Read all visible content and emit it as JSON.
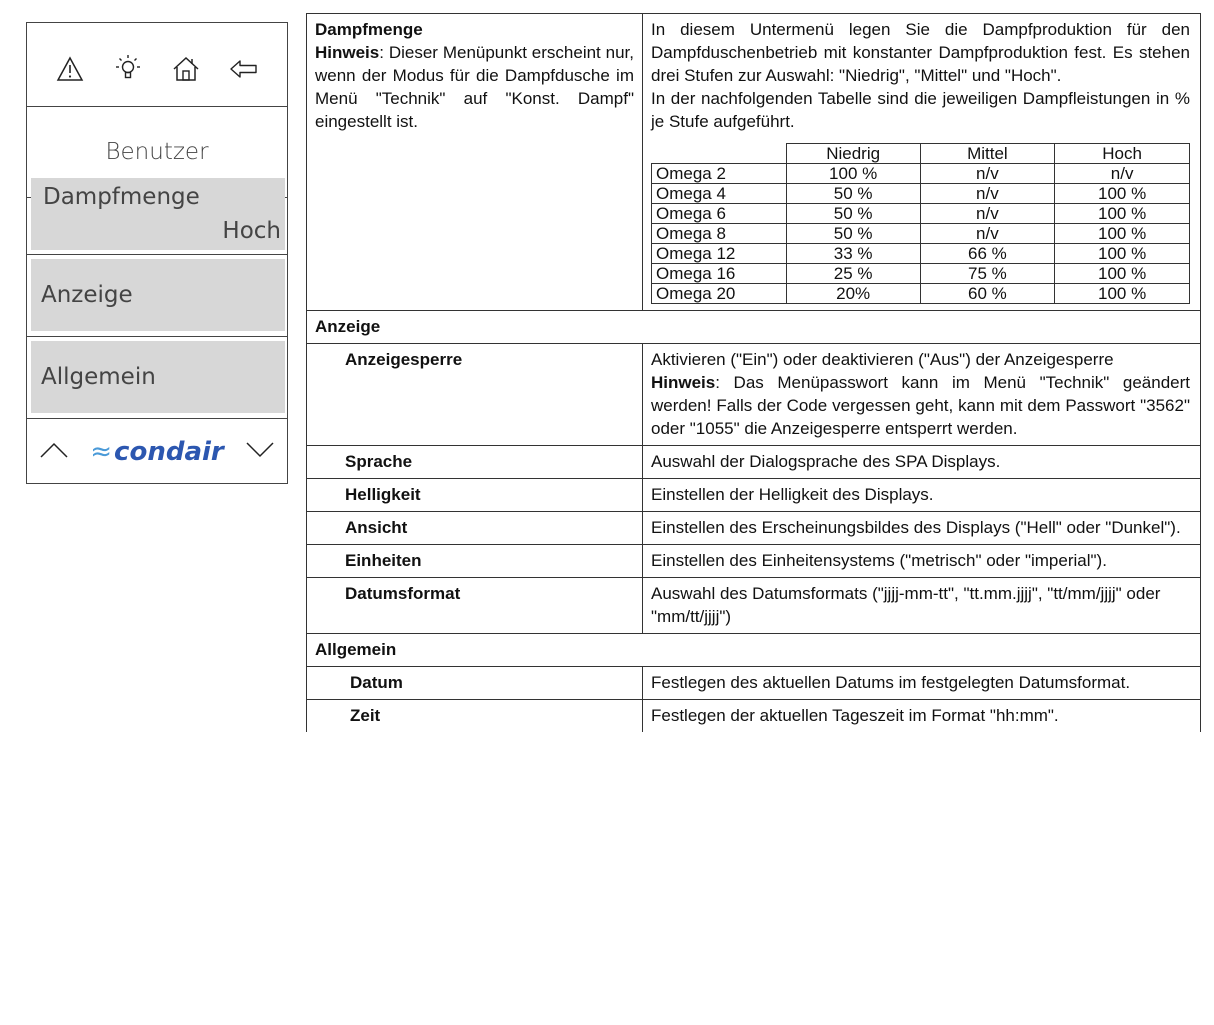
{
  "device": {
    "icons": [
      "warning-icon",
      "bulb-icon",
      "home-icon",
      "back-arrow-icon"
    ],
    "title": "Benutzer",
    "menu": [
      {
        "label": "Dampfmenge",
        "value": "Hoch"
      },
      {
        "label": "Anzeige"
      },
      {
        "label": "Allgemein"
      }
    ],
    "logo": "condair"
  },
  "dampf": {
    "title": "Dampfmenge",
    "note_label": "Hinweis",
    "note_text": ": Dieser Menüpunkt erscheint nur, wenn der Modus für die Dampfdusche im Menü \"Technik\" auf \"Konst. Dampf\" eingestellt ist.",
    "desc1": "In diesem Untermenü legen Sie die Dampfproduktion für den Dampfduschenbetrieb mit konstanter Dampfproduktion fest. Es stehen drei Stufen zur Auswahl: \"Niedrig\", \"Mittel\" und \"Hoch\".",
    "desc2": "In der nachfolgenden Tabelle sind die jeweiligen Dampfleistungen in % je Stufe aufgeführt.",
    "table": {
      "headers": [
        "Niedrig",
        "Mittel",
        "Hoch"
      ],
      "rows": [
        [
          "Omega 2",
          "100 %",
          "n/v",
          "n/v"
        ],
        [
          "Omega 4",
          "50 %",
          "n/v",
          "100 %"
        ],
        [
          "Omega 6",
          "50 %",
          "n/v",
          "100 %"
        ],
        [
          "Omega 8",
          "50 %",
          "n/v",
          "100 %"
        ],
        [
          "Omega 12",
          "33 %",
          "66 %",
          "100 %"
        ],
        [
          "Omega 16",
          "25 %",
          "75 %",
          "100 %"
        ],
        [
          "Omega 20",
          "20%",
          "60 %",
          "100 %"
        ]
      ]
    }
  },
  "anzeige": {
    "heading": "Anzeige",
    "rows": [
      {
        "label": "Anzeigesperre",
        "desc": "Aktivieren (\"Ein\") oder deaktivieren (\"Aus\") der Anzeigesperre",
        "note_label": "Hinweis",
        "note_text": ": Das Menüpasswort kann im Menü \"Technik\" geändert werden! Falls der Code vergessen geht, kann mit dem Passwort \"3562\" oder \"1055\" die Anzeigesperre entsperrt werden."
      },
      {
        "label": "Sprache",
        "desc": "Auswahl der Dialogsprache des SPA Displays."
      },
      {
        "label": "Helligkeit",
        "desc": "Einstellen der Helligkeit des Displays."
      },
      {
        "label": "Ansicht",
        "desc": "Einstellen des Erscheinungsbildes des Displays (\"Hell\" oder \"Dunkel\")."
      },
      {
        "label": "Einheiten",
        "desc": "Einstellen des Einheitensystems (\"metrisch\" oder \"imperial\")."
      },
      {
        "label": "Datumsformat",
        "desc": "Auswahl des Datumsformats (\"jjjj-mm-tt\", \"tt.mm.jjjj\", \"tt/mm/jjjj\" oder \"mm/tt/jjjj\")"
      }
    ]
  },
  "allgemein": {
    "heading": "Allgemein",
    "rows": [
      {
        "label": "Datum",
        "desc": "Festlegen des aktuellen Datums im festgelegten Datumsformat."
      },
      {
        "label": "Zeit",
        "desc": "Festlegen der aktuellen Tageszeit im Format \"hh:mm\"."
      }
    ]
  }
}
